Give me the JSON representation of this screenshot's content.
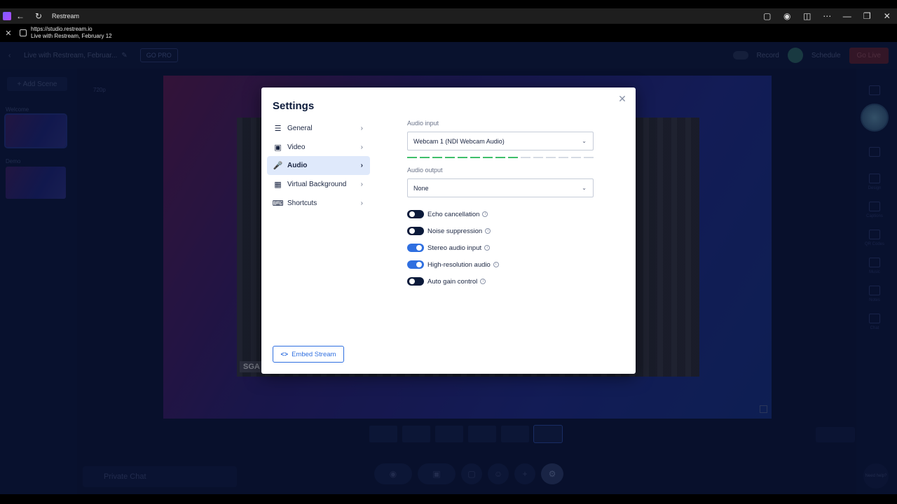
{
  "window": {
    "title": "Restream",
    "url": "https://studio.restream.io",
    "page_title": "Live with Restream, February 12"
  },
  "topnav": {
    "stream_title": "Live with Restream, Februar...",
    "gopro": "GO PRO",
    "record": "Record",
    "schedule": "Schedule",
    "golive": "Go Live"
  },
  "left": {
    "add_scene": "+ Add Scene",
    "scenes": [
      {
        "name": "Welcome"
      },
      {
        "name": "Demo"
      }
    ]
  },
  "stage": {
    "resolution": "720p",
    "name_tag": "SGA"
  },
  "right": {
    "items": [
      "Design",
      "Captions",
      "QR Codes",
      "Music",
      "Notes",
      "Chat"
    ]
  },
  "bottom": {
    "private_chat": "Private Chat",
    "need_help": "Need help?"
  },
  "settings": {
    "title": "Settings",
    "menu": [
      {
        "label": "General",
        "icon": "sliders-icon"
      },
      {
        "label": "Video",
        "icon": "camera-icon"
      },
      {
        "label": "Audio",
        "icon": "microphone-icon",
        "active": true
      },
      {
        "label": "Virtual Background",
        "icon": "image-icon"
      },
      {
        "label": "Shortcuts",
        "icon": "keyboard-icon"
      }
    ],
    "audio_input_label": "Audio input",
    "audio_input_value": "Webcam 1 (NDI Webcam Audio)",
    "audio_output_label": "Audio output",
    "audio_output_value": "None",
    "level_meter": {
      "active_segments": 9,
      "total_segments": 15
    },
    "toggles": [
      {
        "label": "Echo cancellation",
        "on": false
      },
      {
        "label": "Noise suppression",
        "on": false
      },
      {
        "label": "Stereo audio input",
        "on": true
      },
      {
        "label": "High-resolution audio",
        "on": true
      },
      {
        "label": "Auto gain control",
        "on": false
      }
    ],
    "embed_button": "Embed Stream"
  },
  "colors": {
    "accent": "#2f6fe0",
    "meter_active": "#3fbf6a",
    "meter_inactive": "#d6dbe4",
    "app_bg": "#0b1534"
  }
}
